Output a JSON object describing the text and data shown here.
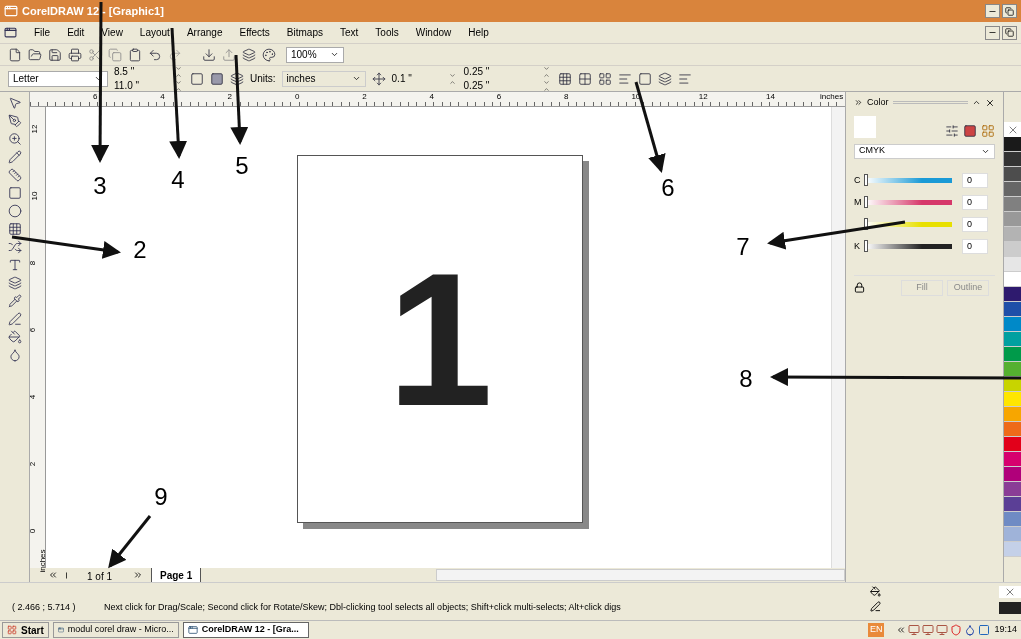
{
  "window": {
    "title": "CorelDRAW 12 - [Graphic1]"
  },
  "menu": [
    "File",
    "Edit",
    "View",
    "Layout",
    "Arrange",
    "Effects",
    "Bitmaps",
    "Text",
    "Tools",
    "Window",
    "Help"
  ],
  "toolbar": {
    "zoom": "100%"
  },
  "property_bar": {
    "paper": "Letter",
    "width": "8.5 \"",
    "height": "11.0 \"",
    "units_label": "Units:",
    "units": "inches",
    "nudge": "0.1 \"",
    "dup_x": "0.25 \"",
    "dup_y": "0.25 \""
  },
  "top_ruler": [
    "6",
    "4",
    "2",
    "0",
    "2",
    "4",
    "6",
    "8",
    "10",
    "12",
    "14",
    "inches"
  ],
  "left_ruler": [
    "12",
    "10",
    "8",
    "6",
    "4",
    "2",
    "0",
    "inches"
  ],
  "page_content": "1",
  "page_nav": {
    "counter": "1 of 1",
    "tabs": [
      {
        "label": "Page 1",
        "selected": true
      }
    ]
  },
  "color_docker": {
    "title": "Color",
    "model": "CMYK",
    "channels": [
      {
        "label": "C",
        "level": 0,
        "value": "0",
        "color": "#1a9ad6"
      },
      {
        "label": "M",
        "level": 0,
        "value": "0",
        "color": "#d6386a"
      },
      {
        "level": 0,
        "value": "0",
        "color": "#e8e000"
      },
      {
        "label": "K",
        "level": 0,
        "value": "0",
        "color": "#222222"
      }
    ],
    "buttons": [
      {
        "label": "Fill",
        "disabled": true
      },
      {
        "label": "Outline",
        "disabled": true
      }
    ]
  },
  "palette": [
    {
      "color": "#1a1a1a"
    },
    {
      "color": "#333333"
    },
    {
      "color": "#4d4d4d"
    },
    {
      "color": "#666666"
    },
    {
      "color": "#808080"
    },
    {
      "color": "#999999"
    },
    {
      "color": "#b3b3b3"
    },
    {
      "color": "#cccccc"
    },
    {
      "color": "#e6e6e6"
    },
    {
      "color": "#ffffff"
    },
    {
      "color": "#2e1a6e"
    },
    {
      "color": "#1f4fa8"
    },
    {
      "color": "#0089c8"
    },
    {
      "color": "#00a0a0"
    },
    {
      "color": "#009a4a"
    },
    {
      "color": "#55b030"
    },
    {
      "color": "#c8d400"
    },
    {
      "color": "#ffe600"
    },
    {
      "color": "#f7a600"
    },
    {
      "color": "#ee6a1a"
    },
    {
      "color": "#e2001a"
    },
    {
      "color": "#d6006e"
    },
    {
      "color": "#b0007a"
    },
    {
      "color": "#8a3d96"
    },
    {
      "color": "#5b3f96"
    },
    {
      "color": "#6f8bc4"
    },
    {
      "color": "#9fb3d9"
    },
    {
      "color": "#c4d0e8"
    }
  ],
  "status_bar": {
    "coordinates": "( 2.466 ; 5.714 )",
    "hint": "Next click for Drag/Scale; Second click for Rotate/Skew; Dbl-clicking tool selects all objects; Shift+click multi-selects; Alt+click digs"
  },
  "taskbar": {
    "start": "Start",
    "tasks": [
      {
        "label": "modul corel draw - Micro...",
        "selected": false
      },
      {
        "label": "CorelDRAW 12 - [Gra...",
        "selected": true
      }
    ],
    "language": "EN",
    "clock": "19:14"
  },
  "annotations": [
    "2",
    "3",
    "4",
    "5",
    "6",
    "7",
    "8",
    "9"
  ]
}
